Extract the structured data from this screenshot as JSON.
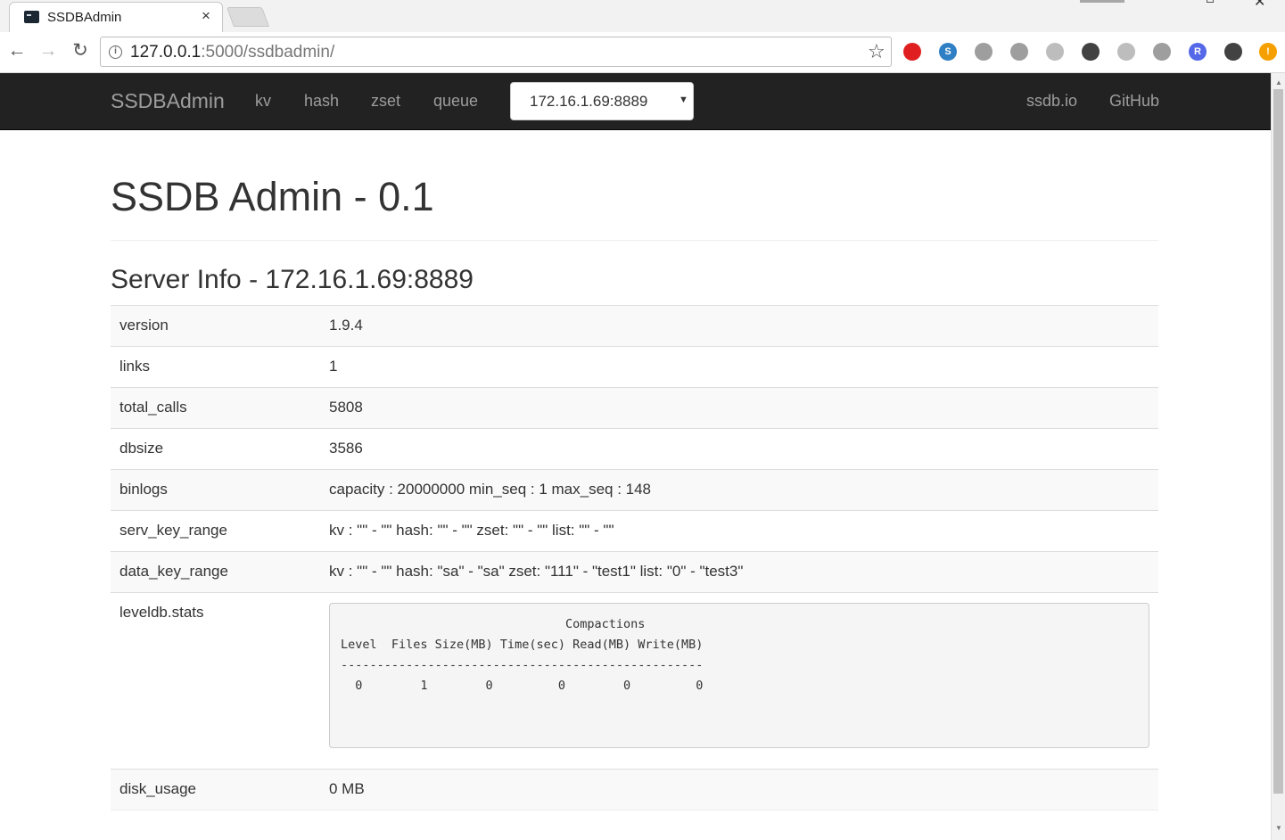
{
  "browser": {
    "tab_title": "SSDBAdmin",
    "tab_close": "×",
    "url_host": "127.0.0.1",
    "url_rest": ":5000/ssdbadmin/",
    "nav_back": "←",
    "nav_forward": "→",
    "nav_reload": "↻",
    "star": "☆",
    "extensions": [
      {
        "name": "adblock-extension-icon",
        "color": "#e02020",
        "label": ""
      },
      {
        "name": "s-extension-icon",
        "color": "#2f7fc4",
        "label": "S"
      },
      {
        "name": "cursor-extension-icon",
        "color": "#9e9e9e",
        "label": ""
      },
      {
        "name": "circle-extension-icon",
        "color": "#9e9e9e",
        "label": ""
      },
      {
        "name": "swirl-extension-icon",
        "color": "#bdbdbd",
        "label": ""
      },
      {
        "name": "translate-extension-icon",
        "color": "#424242",
        "label": ""
      },
      {
        "name": "shield-extension-icon",
        "color": "#bdbdbd",
        "label": ""
      },
      {
        "name": "layout-extension-icon",
        "color": "#9e9e9e",
        "label": ""
      },
      {
        "name": "r-extension-icon",
        "color": "#5468e8",
        "label": "R"
      },
      {
        "name": "dark-extension-icon",
        "color": "#424242",
        "label": ""
      },
      {
        "name": "alert-extension-icon",
        "color": "#f5a000",
        "label": "!"
      }
    ]
  },
  "navbar": {
    "brand": "SSDBAdmin",
    "links": [
      "kv",
      "hash",
      "zset",
      "queue"
    ],
    "server": "172.16.1.69:8889",
    "caret": "▼",
    "right_links": [
      "ssdb.io",
      "GitHub"
    ]
  },
  "page": {
    "title": "SSDB Admin - 0.1",
    "section": "Server Info - 172.16.1.69:8889"
  },
  "info_rows": [
    {
      "key": "version",
      "value": "1.9.4"
    },
    {
      "key": "links",
      "value": "1"
    },
    {
      "key": "total_calls",
      "value": "5808"
    },
    {
      "key": "dbsize",
      "value": "3586"
    },
    {
      "key": "binlogs",
      "value": "capacity : 20000000 min_seq : 1 max_seq : 148"
    },
    {
      "key": "serv_key_range",
      "value": "kv : \"\" - \"\" hash: \"\" - \"\" zset: \"\" - \"\" list: \"\" - \"\""
    },
    {
      "key": "data_key_range",
      "value": "kv : \"\" - \"\" hash: \"sa\" - \"sa\" zset: \"111\" - \"test1\" list: \"0\" - \"test3\""
    }
  ],
  "leveldb": {
    "key": "leveldb.stats",
    "text": "                               Compactions\nLevel  Files Size(MB) Time(sec) Read(MB) Write(MB)\n--------------------------------------------------\n  0        1        0         0        0         0"
  },
  "disk_usage": {
    "key": "disk_usage",
    "value": "0 MB"
  }
}
